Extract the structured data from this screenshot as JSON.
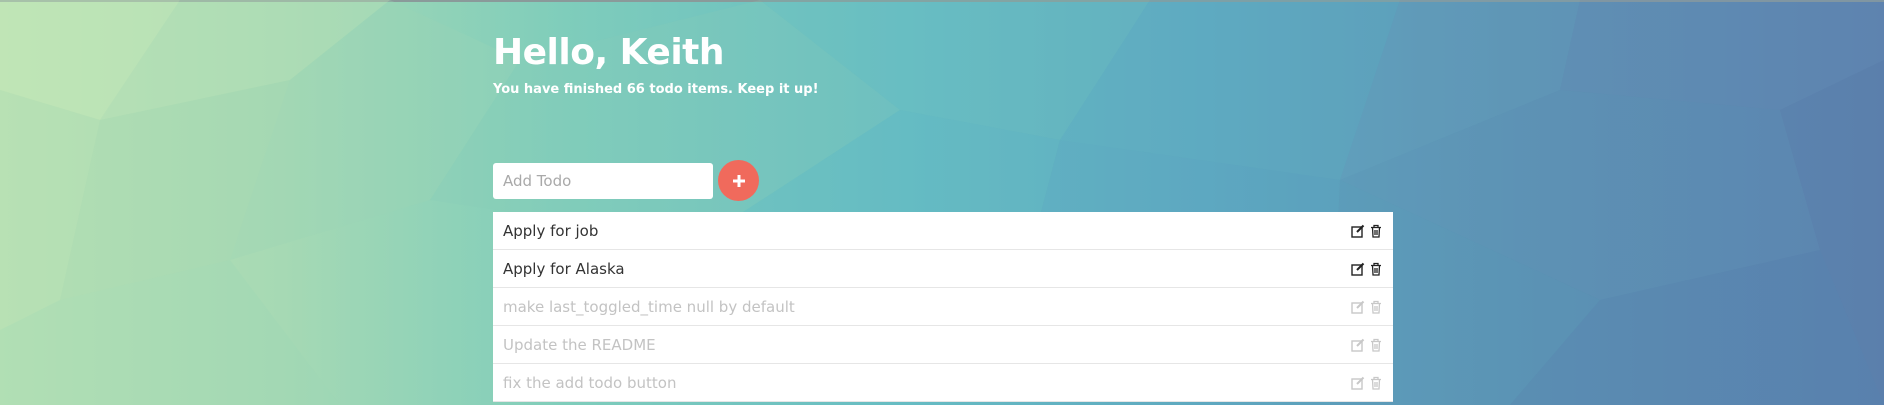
{
  "header": {
    "greeting": "Hello, Keith",
    "subtitle": "You have finished 66 todo items. Keep it up!"
  },
  "add_todo": {
    "placeholder": "Add Todo",
    "value": "",
    "button_icon": "plus-icon",
    "button_color": "#f06a5c"
  },
  "todos": [
    {
      "text": "Apply for job",
      "done": false
    },
    {
      "text": "Apply for Alaska",
      "done": false
    },
    {
      "text": "make last_toggled_time null by default",
      "done": true
    },
    {
      "text": "Update the README",
      "done": true
    },
    {
      "text": "fix the add todo button",
      "done": true
    }
  ],
  "icons": {
    "edit": "edit-icon",
    "delete": "trash-icon"
  }
}
